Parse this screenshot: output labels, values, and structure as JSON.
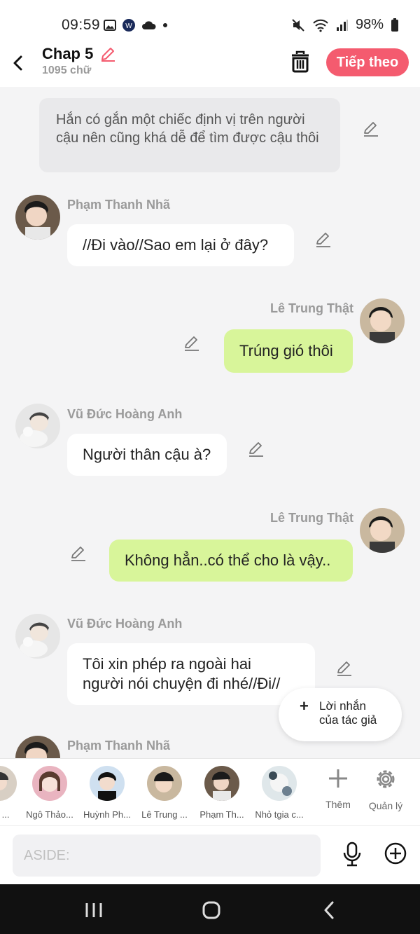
{
  "status_bar": {
    "time": "09:59",
    "battery": "98%"
  },
  "header": {
    "title": "Chap 5",
    "word_count": "1095 chữ",
    "next_label": "Tiếp theo"
  },
  "messages": [
    {
      "type": "narration",
      "text": "Hắn có gắn một chiếc định vị trên người cậu nên cũng khá dễ để tìm được cậu thôi"
    },
    {
      "side": "left",
      "name": "Phạm Thanh Nhã",
      "text": "//Đi vào//Sao em lại ở đây?"
    },
    {
      "side": "right",
      "name": "Lê Trung Thật",
      "text": "Trúng gió thôi"
    },
    {
      "side": "left",
      "name": "Vũ Đức Hoàng Anh",
      "text": "Người thân cậu à?"
    },
    {
      "side": "right",
      "name": "Lê Trung Thật",
      "text": "Không hẳn..có thể cho là vậy.."
    },
    {
      "side": "left",
      "name": "Vũ Đức Hoàng Anh",
      "text_line1": "Tôi xin phép ra ngoài hai",
      "text_line2": "người nói chuyện đi nhé//Đi//"
    },
    {
      "side": "left",
      "name": "Phạm Thanh Nhã"
    }
  ],
  "author_note": {
    "line1": "Lời nhắn",
    "line2": "của tác giả"
  },
  "characters": [
    {
      "name": "Lê ..."
    },
    {
      "name": "Ngô Thảo..."
    },
    {
      "name": "Huỳnh Ph..."
    },
    {
      "name": "Lê Trung ..."
    },
    {
      "name": "Phạm Th..."
    },
    {
      "name": "Nhỏ tgia c..."
    }
  ],
  "tools": {
    "add_label": "Thêm",
    "manage_label": "Quản lý"
  },
  "input": {
    "placeholder": "ASIDE:"
  },
  "colors": {
    "accent": "#f45b6f",
    "bubble_green": "#d8f59a",
    "background": "#f4f4f5"
  }
}
